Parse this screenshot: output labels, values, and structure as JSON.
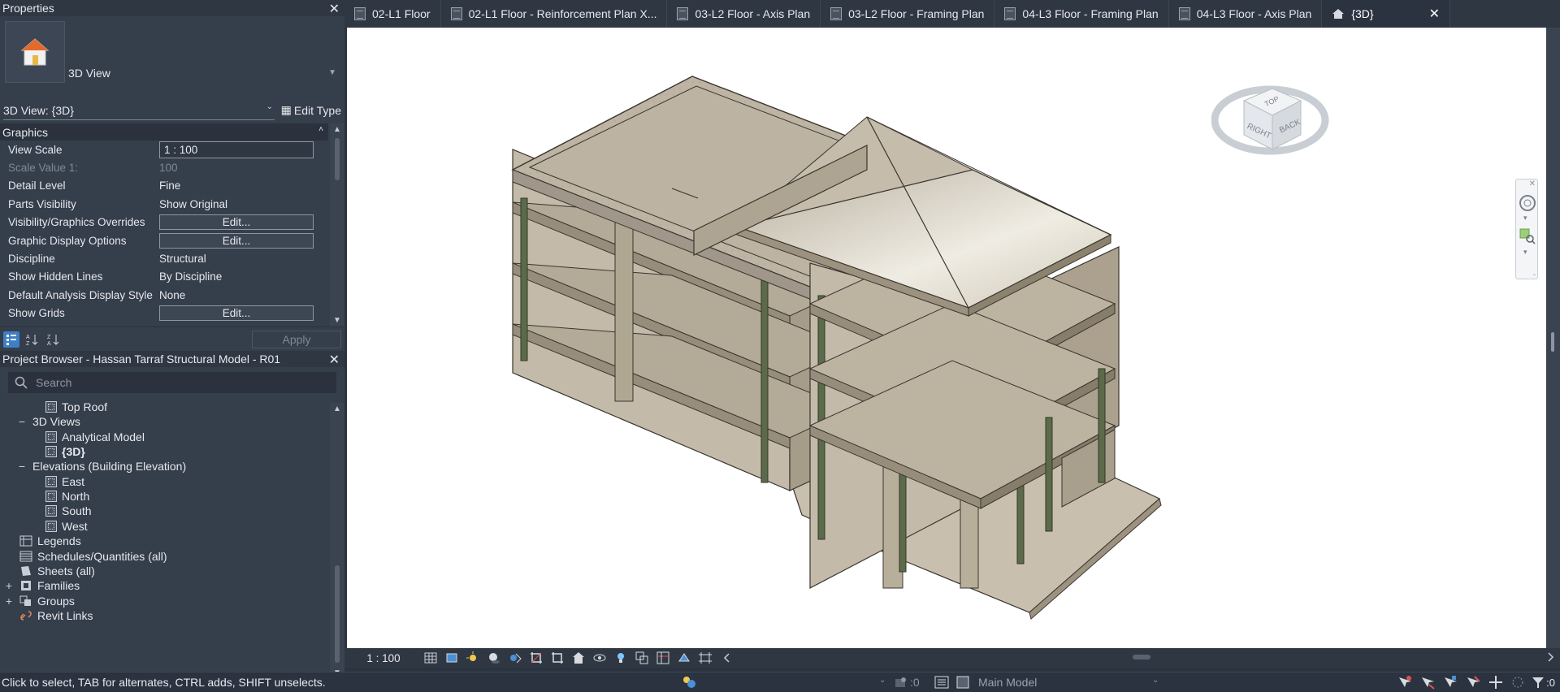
{
  "properties": {
    "title": "Properties",
    "type_name": "3D View",
    "view_selector": "3D View: {3D}",
    "edit_type": "Edit Type",
    "group": "Graphics",
    "rows": [
      {
        "key": "View Scale",
        "value": "1 : 100",
        "kind": "input"
      },
      {
        "key": "Scale Value    1:",
        "value": "100",
        "kind": "dim"
      },
      {
        "key": "Detail Level",
        "value": "Fine",
        "kind": "text"
      },
      {
        "key": "Parts Visibility",
        "value": "Show Original",
        "kind": "text"
      },
      {
        "key": "Visibility/Graphics Overrides",
        "value": "Edit...",
        "kind": "button"
      },
      {
        "key": "Graphic Display Options",
        "value": "Edit...",
        "kind": "button"
      },
      {
        "key": "Discipline",
        "value": "Structural",
        "kind": "text"
      },
      {
        "key": "Show Hidden Lines",
        "value": "By Discipline",
        "kind": "text"
      },
      {
        "key": "Default Analysis Display Style",
        "value": "None",
        "kind": "text"
      },
      {
        "key": "Show Grids",
        "value": "Edit...",
        "kind": "button"
      }
    ],
    "apply": "Apply"
  },
  "browser": {
    "title": "Project Browser - Hassan Tarraf Structural Model - R01",
    "search_placeholder": "Search",
    "items": [
      {
        "label": "Top Roof",
        "level": 2,
        "icon": "view"
      },
      {
        "label": "3D Views",
        "level": 1,
        "toggle": "−"
      },
      {
        "label": "Analytical Model",
        "level": 2,
        "icon": "view"
      },
      {
        "label": "{3D}",
        "level": 2,
        "icon": "view",
        "bold": true
      },
      {
        "label": "Elevations (Building Elevation)",
        "level": 1,
        "toggle": "−"
      },
      {
        "label": "East",
        "level": 2,
        "icon": "view"
      },
      {
        "label": "North",
        "level": 2,
        "icon": "view"
      },
      {
        "label": "South",
        "level": 2,
        "icon": "view"
      },
      {
        "label": "West",
        "level": 2,
        "icon": "view"
      },
      {
        "label": "Legends",
        "level": 0,
        "icon": "legend"
      },
      {
        "label": "Schedules/Quantities (all)",
        "level": 0,
        "icon": "schedule"
      },
      {
        "label": "Sheets (all)",
        "level": 0,
        "icon": "sheet"
      },
      {
        "label": "Families",
        "level": 0,
        "toggle": "+",
        "icon": "family"
      },
      {
        "label": "Groups",
        "level": 0,
        "toggle": "+",
        "icon": "group"
      },
      {
        "label": "Revit Links",
        "level": 0,
        "icon": "link"
      }
    ]
  },
  "tabs": [
    {
      "label": "02-L1 Floor"
    },
    {
      "label": "02-L1 Floor - Reinforcement Plan X..."
    },
    {
      "label": "03-L2 Floor - Axis Plan"
    },
    {
      "label": "03-L2 Floor - Framing Plan"
    },
    {
      "label": "04-L3 Floor - Framing Plan"
    },
    {
      "label": "04-L3 Floor - Axis Plan"
    },
    {
      "label": "{3D}",
      "active": true
    }
  ],
  "viewcube": {
    "top": "TOP",
    "right": "RIGHT",
    "back": "BACK"
  },
  "viewbar": {
    "scale": "1 : 100"
  },
  "status": {
    "message": "Click to select, TAB for alternates, CTRL adds, SHIFT unselects.",
    "worksharing_count": ":0",
    "model": "Main Model",
    "filter_count": ":0"
  }
}
